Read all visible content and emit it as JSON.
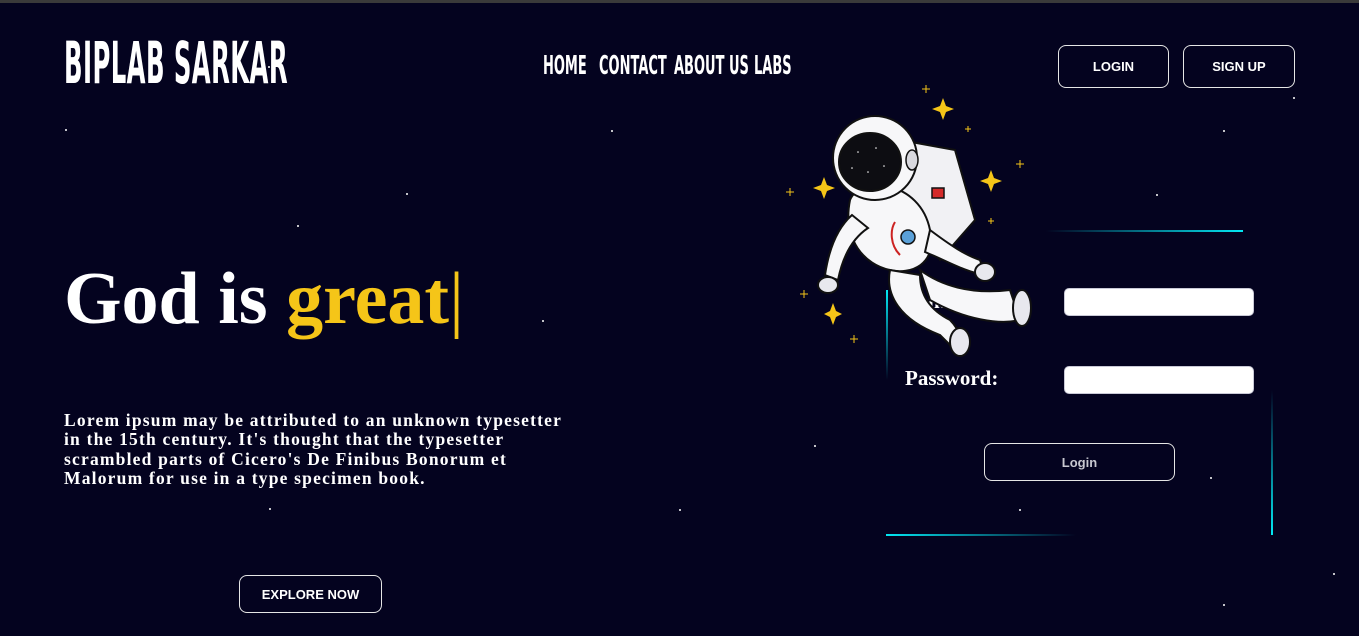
{
  "brand": {
    "logo_text": "BIPLAB SARKAR"
  },
  "nav": {
    "items": [
      "HOME",
      "CONTACT",
      "ABOUT US",
      "LABS"
    ]
  },
  "header_buttons": {
    "login": "LOGIN",
    "signup": "SIGN UP"
  },
  "hero": {
    "headline_prefix": "God is ",
    "headline_accent": "great",
    "cursor": "|",
    "body": "Lorem ipsum may be attributed to an unknown typesetter in the 15th century. It's thought that the typesetter scrambled parts of Cicero's De Finibus Bonorum et Malorum for use in a type specimen book.",
    "cta": "EXPLORE NOW"
  },
  "login_form": {
    "username_label_visible": "na",
    "password_label": "Password:",
    "username_value": "",
    "password_value": "",
    "submit": "Login"
  },
  "colors": {
    "background": "#04031f",
    "accent": "#f5c518",
    "glow": "#03e8f4"
  },
  "icons": {
    "illustration": "astronaut-illustration"
  }
}
